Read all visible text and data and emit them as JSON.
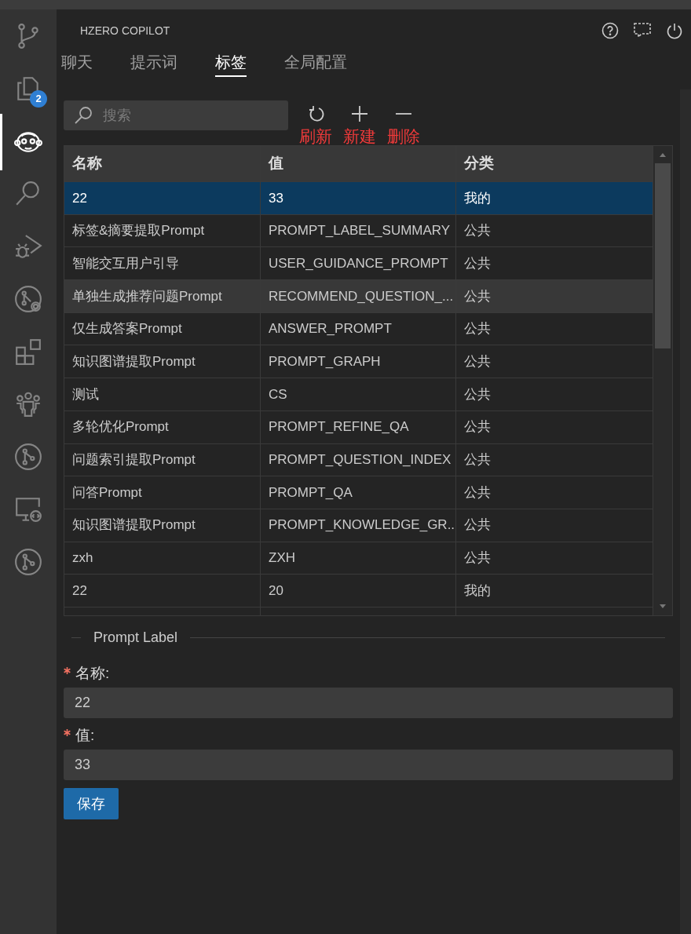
{
  "activity_bar": [
    {
      "kind": "branch",
      "active": false
    },
    {
      "kind": "files",
      "active": false,
      "badge": "2"
    },
    {
      "kind": "monkey",
      "active": true
    },
    {
      "kind": "search",
      "active": false
    },
    {
      "kind": "debug",
      "active": false
    },
    {
      "kind": "branch-search",
      "active": false
    },
    {
      "kind": "blocks",
      "active": false
    },
    {
      "kind": "people",
      "active": false
    },
    {
      "kind": "branch-circle",
      "active": false
    },
    {
      "kind": "remote",
      "active": false
    },
    {
      "kind": "branch-circle",
      "active": false
    }
  ],
  "panel": {
    "title": "HZERO COPILOT"
  },
  "tabs": [
    {
      "label": "聊天",
      "selected": false
    },
    {
      "label": "提示词",
      "selected": false
    },
    {
      "label": "标签",
      "selected": true
    },
    {
      "label": "全局配置",
      "selected": false
    }
  ],
  "search": {
    "placeholder": "搜索"
  },
  "actions": [
    {
      "kind": "refresh",
      "note": "刷新"
    },
    {
      "kind": "add",
      "note": "新建"
    },
    {
      "kind": "remove",
      "note": "删除"
    }
  ],
  "table": {
    "columns": [
      "名称",
      "值",
      "分类"
    ],
    "rows": [
      {
        "cells": [
          "22",
          "33",
          "我的"
        ],
        "selected": true,
        "highlighted": false
      },
      {
        "cells": [
          "标签&摘要提取Prompt",
          "PROMPT_LABEL_SUMMARY",
          "公共"
        ],
        "selected": false,
        "highlighted": false
      },
      {
        "cells": [
          "智能交互用户引导",
          "USER_GUIDANCE_PROMPT",
          "公共"
        ],
        "selected": false,
        "highlighted": false
      },
      {
        "cells": [
          "单独生成推荐问题Prompt",
          "RECOMMEND_QUESTION_...",
          "公共"
        ],
        "selected": false,
        "highlighted": true
      },
      {
        "cells": [
          "仅生成答案Prompt",
          "ANSWER_PROMPT",
          "公共"
        ],
        "selected": false,
        "highlighted": false
      },
      {
        "cells": [
          "知识图谱提取Prompt",
          "PROMPT_GRAPH",
          "公共"
        ],
        "selected": false,
        "highlighted": false
      },
      {
        "cells": [
          "测试",
          "CS",
          "公共"
        ],
        "selected": false,
        "highlighted": false
      },
      {
        "cells": [
          "多轮优化Prompt",
          "PROMPT_REFINE_QA",
          "公共"
        ],
        "selected": false,
        "highlighted": false
      },
      {
        "cells": [
          "问题索引提取Prompt",
          "PROMPT_QUESTION_INDEX",
          "公共"
        ],
        "selected": false,
        "highlighted": false
      },
      {
        "cells": [
          "问答Prompt",
          "PROMPT_QA",
          "公共"
        ],
        "selected": false,
        "highlighted": false
      },
      {
        "cells": [
          "知识图谱提取Prompt",
          "PROMPT_KNOWLEDGE_GR...",
          "公共"
        ],
        "selected": false,
        "highlighted": false
      },
      {
        "cells": [
          "zxh",
          "ZXH",
          "公共"
        ],
        "selected": false,
        "highlighted": false
      },
      {
        "cells": [
          "22",
          "20",
          "我的"
        ],
        "selected": false,
        "highlighted": false
      }
    ]
  },
  "form": {
    "title": "Prompt Label",
    "fields": [
      {
        "label": "名称:",
        "required": true,
        "value": "22"
      },
      {
        "label": "值:",
        "required": true,
        "value": "33"
      }
    ],
    "save_button": "保存"
  }
}
